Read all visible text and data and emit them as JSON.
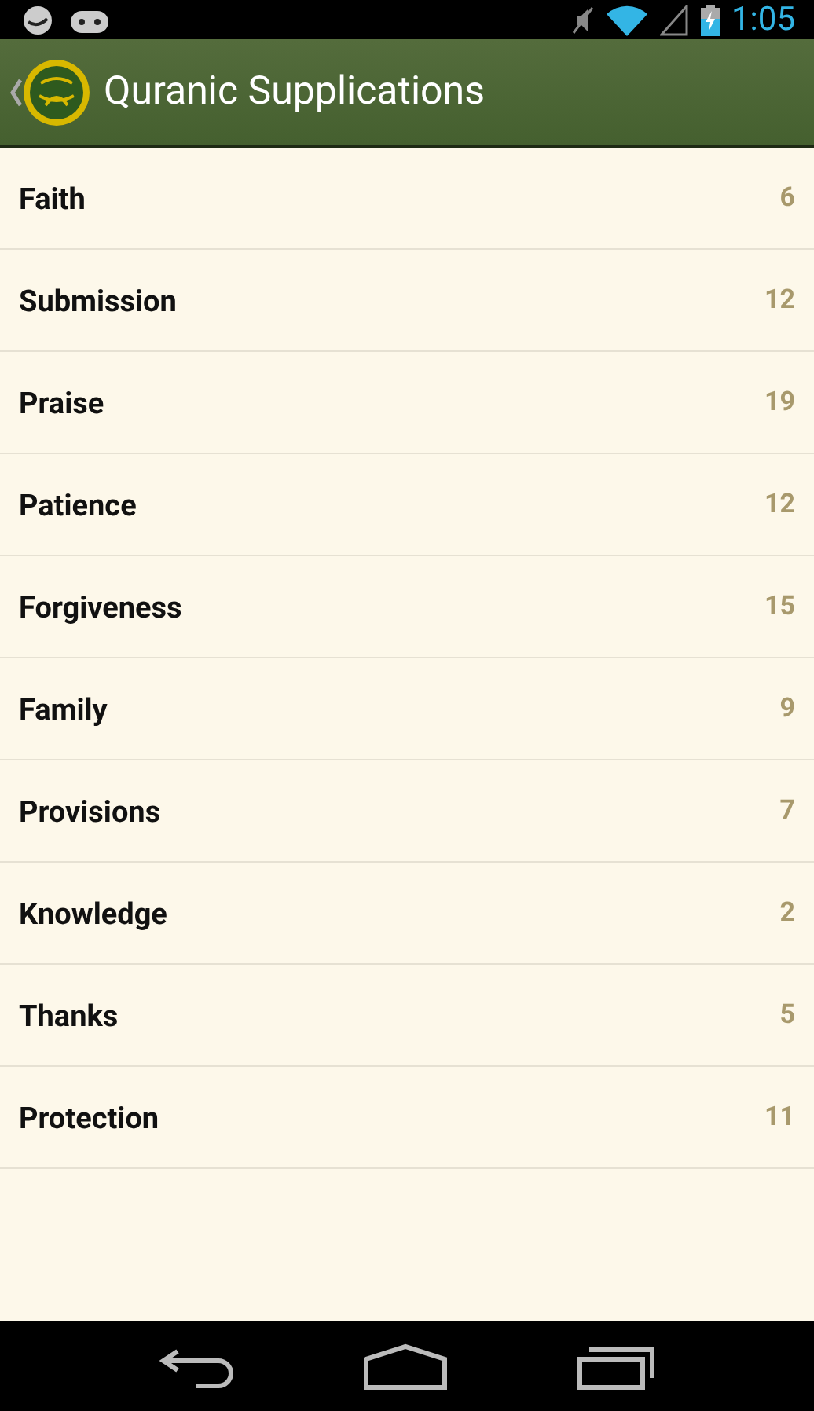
{
  "status_bar": {
    "time": "1:05"
  },
  "action_bar": {
    "title": "Quranic Supplications"
  },
  "categories": [
    {
      "name": "Faith",
      "count": "6"
    },
    {
      "name": "Submission",
      "count": "12"
    },
    {
      "name": "Praise",
      "count": "19"
    },
    {
      "name": "Patience",
      "count": "12"
    },
    {
      "name": "Forgiveness",
      "count": "15"
    },
    {
      "name": "Family",
      "count": "9"
    },
    {
      "name": "Provisions",
      "count": "7"
    },
    {
      "name": "Knowledge",
      "count": "2"
    },
    {
      "name": "Thanks",
      "count": "5"
    },
    {
      "name": "Protection",
      "count": "11"
    }
  ]
}
